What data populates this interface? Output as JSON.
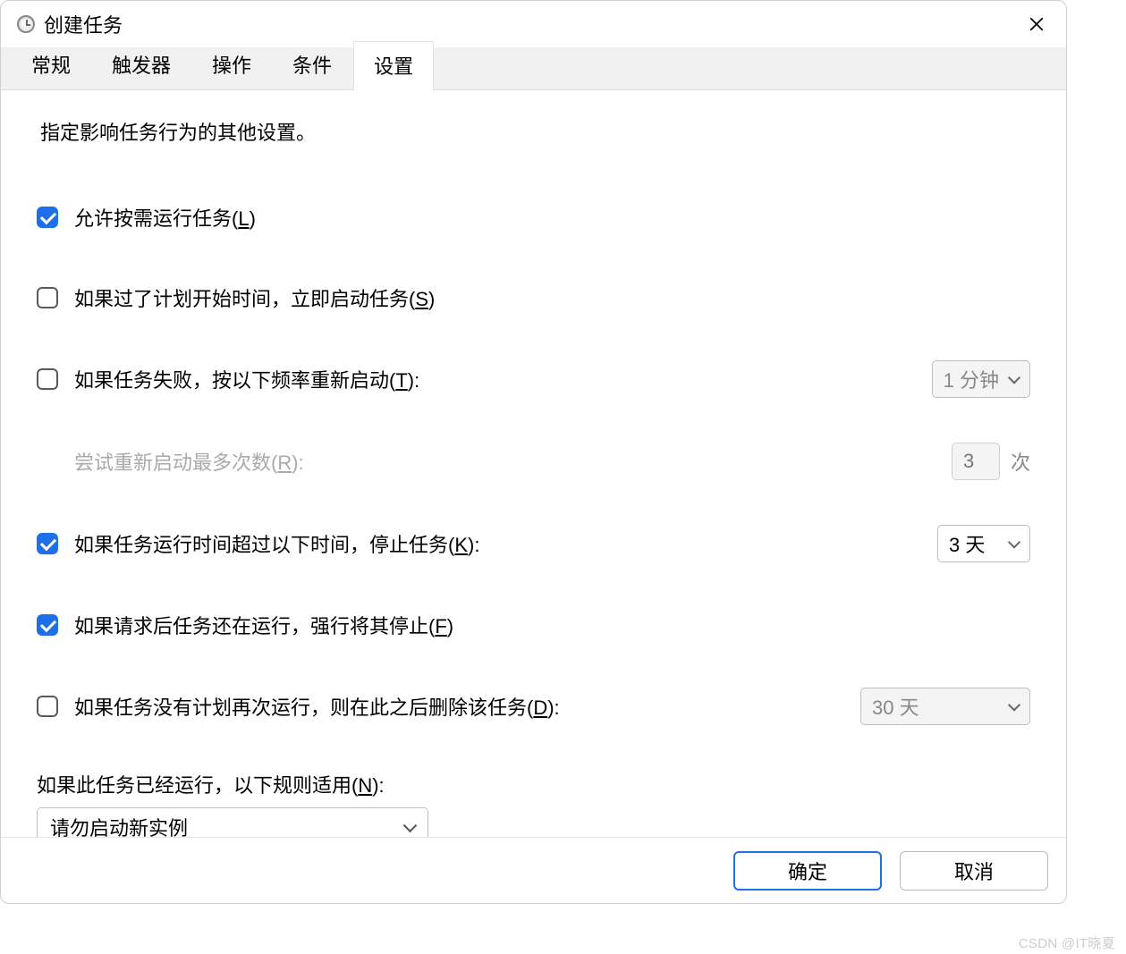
{
  "title": "创建任务",
  "tabs": {
    "general": "常规",
    "triggers": "触发器",
    "actions": "操作",
    "conditions": "条件",
    "settings": "设置"
  },
  "settings": {
    "description": "指定影响任务行为的其他设置。",
    "allow_on_demand": {
      "label_pre": "允许按需运行任务(",
      "hotkey": "L",
      "label_post": ")",
      "checked": true
    },
    "start_if_missed": {
      "label_pre": "如果过了计划开始时间，立即启动任务(",
      "hotkey": "S",
      "label_post": ")",
      "checked": false
    },
    "restart_on_fail": {
      "label_pre": "如果任务失败，按以下频率重新启动(",
      "hotkey": "T",
      "label_post": "):",
      "checked": false,
      "interval": "1 分钟"
    },
    "retry_count": {
      "label_pre": "尝试重新启动最多次数(",
      "hotkey": "R",
      "label_post": "):",
      "value": "3",
      "suffix": "次"
    },
    "stop_if_long": {
      "label_pre": "如果任务运行时间超过以下时间，停止任务(",
      "hotkey": "K",
      "label_post": "):",
      "checked": true,
      "value": "3 天"
    },
    "force_stop": {
      "label_pre": "如果请求后任务还在运行，强行将其停止(",
      "hotkey": "F",
      "label_post": ")",
      "checked": true
    },
    "delete_after": {
      "label_pre": "如果任务没有计划再次运行，则在此之后删除该任务(",
      "hotkey": "D",
      "label_post": "):",
      "checked": false,
      "value": "30 天"
    },
    "rule_label": {
      "pre": "如果此任务已经运行，以下规则适用(",
      "hotkey": "N",
      "post": "):"
    },
    "rule_value": "请勿启动新实例"
  },
  "buttons": {
    "ok": "确定",
    "cancel": "取消"
  },
  "watermark": "CSDN @IT晓夏"
}
